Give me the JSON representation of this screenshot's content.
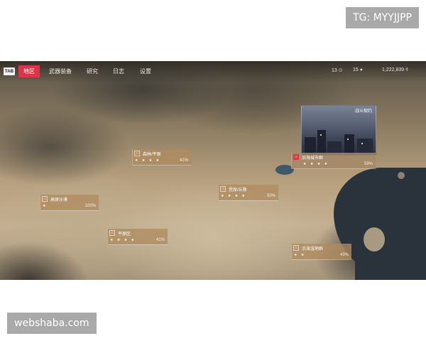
{
  "watermarks": {
    "top_right": "TG: MYYJJPP",
    "bottom_left": "webshaba.com"
  },
  "topbar": {
    "tab_key": "TAB",
    "menu": [
      {
        "label": "地区",
        "active": true
      },
      {
        "label": "武器装备",
        "active": false
      },
      {
        "label": "研究",
        "active": false
      },
      {
        "label": "日志",
        "active": false
      },
      {
        "label": "设置",
        "active": false
      }
    ],
    "resources": {
      "first": {
        "value": "13",
        "icon": "intel-icon",
        "glyph": "⊙"
      },
      "second": {
        "value": "15",
        "icon": "token-icon",
        "glyph": "●"
      },
      "money": {
        "value": "1,222,839",
        "icon": "cash-icon",
        "glyph": "¢"
      }
    }
  },
  "regions": [
    {
      "name": "森林/平原",
      "stars": "★ ★ ★ ★",
      "progress": "41%",
      "selected": false
    },
    {
      "name": "高原沙漠",
      "stars": "★",
      "progress": "100%",
      "selected": false
    },
    {
      "name": "荒原/丘陵",
      "stars": "★ ★ ★ ★",
      "progress": "50%",
      "selected": false
    },
    {
      "name": "平原区",
      "stars": "★ ★ ★ ★",
      "progress": "41%",
      "selected": false
    },
    {
      "name": "沿海城市群",
      "stars": "★ ★ ★ ★",
      "progress": "59%",
      "selected": true
    },
    {
      "name": "沿海湿地群",
      "stars": "★ ★",
      "progress": "43%",
      "selected": false
    }
  ],
  "preview": {
    "title": "战斗契约"
  },
  "colors": {
    "accent": "#e0324a",
    "card": "#b08c60",
    "sea": "#2a333c"
  }
}
